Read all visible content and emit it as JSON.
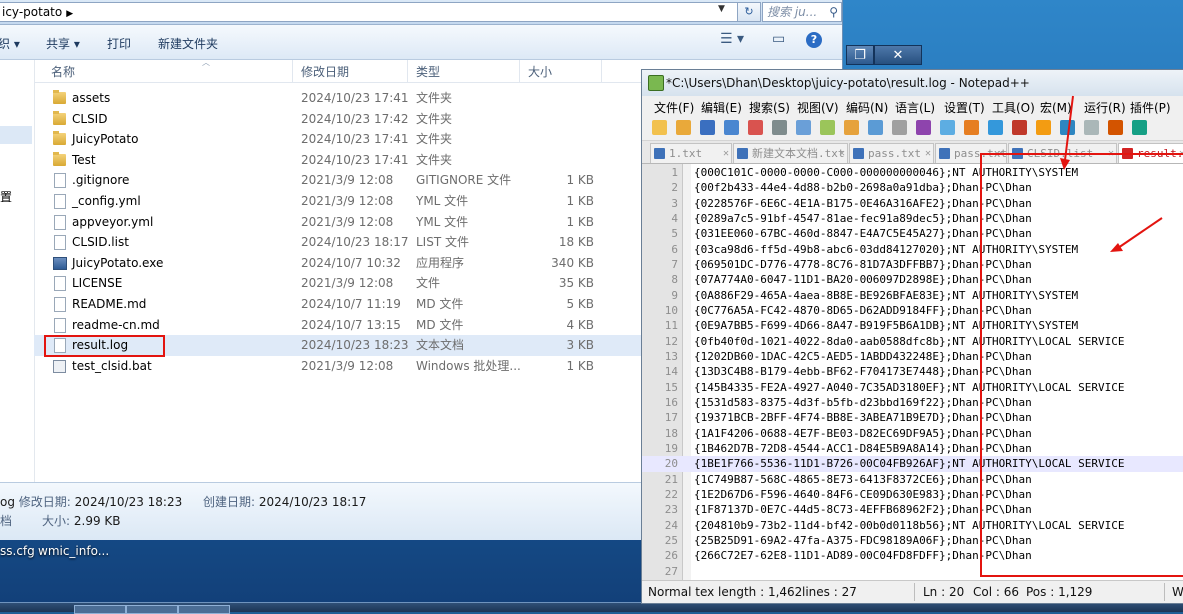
{
  "explorer": {
    "address_path": "icy-potato",
    "search_placeholder": "搜索 ju...",
    "toolbar": {
      "organize": "织 ▾",
      "share": "共享 ▾",
      "print": "打印",
      "new_folder": "新建文件夹"
    },
    "columns": {
      "name": "名称",
      "date": "修改日期",
      "type": "类型",
      "size": "大小"
    },
    "nav_label": "置",
    "files": [
      {
        "icon": "folder",
        "name": "assets",
        "date": "2024/10/23 17:41",
        "type": "文件夹",
        "size": ""
      },
      {
        "icon": "folder",
        "name": "CLSID",
        "date": "2024/10/23 17:42",
        "type": "文件夹",
        "size": ""
      },
      {
        "icon": "folder",
        "name": "JuicyPotato",
        "date": "2024/10/23 17:41",
        "type": "文件夹",
        "size": ""
      },
      {
        "icon": "folder",
        "name": "Test",
        "date": "2024/10/23 17:41",
        "type": "文件夹",
        "size": ""
      },
      {
        "icon": "doc",
        "name": ".gitignore",
        "date": "2021/3/9 12:08",
        "type": "GITIGNORE 文件",
        "size": "1 KB"
      },
      {
        "icon": "doc",
        "name": "_config.yml",
        "date": "2021/3/9 12:08",
        "type": "YML 文件",
        "size": "1 KB"
      },
      {
        "icon": "doc",
        "name": "appveyor.yml",
        "date": "2021/3/9 12:08",
        "type": "YML 文件",
        "size": "1 KB"
      },
      {
        "icon": "doc",
        "name": "CLSID.list",
        "date": "2024/10/23 18:17",
        "type": "LIST 文件",
        "size": "18 KB"
      },
      {
        "icon": "exe",
        "name": "JuicyPotato.exe",
        "date": "2024/10/7 10:32",
        "type": "应用程序",
        "size": "340 KB"
      },
      {
        "icon": "doc",
        "name": "LICENSE",
        "date": "2021/3/9 12:08",
        "type": "文件",
        "size": "35 KB"
      },
      {
        "icon": "doc",
        "name": "README.md",
        "date": "2024/10/7 11:19",
        "type": "MD 文件",
        "size": "5 KB"
      },
      {
        "icon": "doc",
        "name": "readme-cn.md",
        "date": "2024/10/7 13:15",
        "type": "MD 文件",
        "size": "4 KB"
      },
      {
        "icon": "doc",
        "name": "result.log",
        "date": "2024/10/23 18:23",
        "type": "文本文档",
        "size": "3 KB"
      },
      {
        "icon": "bat",
        "name": "test_clsid.bat",
        "date": "2021/3/9 12:08",
        "type": "Windows 批处理...",
        "size": "1 KB"
      }
    ],
    "details": {
      "name_fragment": "og",
      "modified_label": "修改日期:",
      "modified_value": "2024/10/23 18:23",
      "created_label": "创建日期:",
      "created_value": "2024/10/23 18:17",
      "size_label": "大小:",
      "size_value": "2.99 KB",
      "left_fragment": "档"
    }
  },
  "desktop": {
    "labels": [
      "ss.cfg",
      "wmic_info..."
    ]
  },
  "background_window": {
    "restore": "❐",
    "close": "✕"
  },
  "notepad": {
    "title": "*C:\\Users\\Dhan\\Desktop\\juicy-potato\\result.log - Notepad++",
    "menu": [
      "文件(F)",
      "编辑(E)",
      "搜索(S)",
      "视图(V)",
      "编码(N)",
      "语言(L)",
      "设置(T)",
      "工具(O)",
      "宏(M)",
      "运行(R)",
      "插件(P)"
    ],
    "tabs": [
      "1.txt",
      "新建文本文档.txt",
      "pass.txt",
      "pass.txt",
      "CLSID.list",
      "result.log"
    ],
    "lines": [
      "{000C101C-0000-0000-C000-000000000046};NT AUTHORITY\\SYSTEM",
      "{00f2b433-44e4-4d88-b2b0-2698a0a91dba};Dhan-PC\\Dhan",
      "{0228576F-6E6C-4E1A-B175-0E46A316AFE2};Dhan-PC\\Dhan",
      "{0289a7c5-91bf-4547-81ae-fec91a89dec5};Dhan-PC\\Dhan",
      "{031EE060-67BC-460d-8847-E4A7C5E45A27};Dhan-PC\\Dhan",
      "{03ca98d6-ff5d-49b8-abc6-03dd84127020};NT AUTHORITY\\SYSTEM",
      "{069501DC-D776-4778-8C76-81D7A3DFFBB7};Dhan-PC\\Dhan",
      "{07A774A0-6047-11D1-BA20-006097D2898E};Dhan-PC\\Dhan",
      "{0A886F29-465A-4aea-8B8E-BE926BFAE83E};NT AUTHORITY\\SYSTEM",
      "{0C776A5A-FC42-4870-8D65-D62ADD9184FF};Dhan-PC\\Dhan",
      "{0E9A7BB5-F699-4D66-8A47-B919F5B6A1DB};NT AUTHORITY\\SYSTEM",
      "{0fb40f0d-1021-4022-8da0-aab0588dfc8b};NT AUTHORITY\\LOCAL SERVICE",
      "{1202DB60-1DAC-42C5-AED5-1ABDD432248E};Dhan-PC\\Dhan",
      "{13D3C4B8-B179-4ebb-BF62-F704173E7448};Dhan-PC\\Dhan",
      "{145B4335-FE2A-4927-A040-7C35AD3180EF};NT AUTHORITY\\LOCAL SERVICE",
      "{1531d583-8375-4d3f-b5fb-d23bbd169f22};Dhan-PC\\Dhan",
      "{19371BCB-2BFF-4F74-BB8E-3ABEA71B9E7D};Dhan-PC\\Dhan",
      "{1A1F4206-0688-4E7F-BE03-D82EC69DF9A5};Dhan-PC\\Dhan",
      "{1B462D7B-72D8-4544-ACC1-D84E5B9A8A14};Dhan-PC\\Dhan",
      "{1BE1F766-5536-11D1-B726-00C04FB926AF};NT AUTHORITY\\LOCAL SERVICE",
      "{1C749B87-568C-4865-8E73-6413F8372CE6};Dhan-PC\\Dhan",
      "{1E2D67D6-F596-4640-84F6-CE09D630E983};Dhan-PC\\Dhan",
      "{1F87137D-0E7C-44d5-8C73-4EFFB68962F2};Dhan-PC\\Dhan",
      "{204810b9-73b2-11d4-bf42-00b0d0118b56};NT AUTHORITY\\LOCAL SERVICE",
      "{25B25D91-69A2-47fa-A375-FDC98189A06F};Dhan-PC\\Dhan",
      "{266C72E7-62E8-11D1-AD89-00C04FD8FDFF};Dhan-PC\\Dhan",
      ""
    ],
    "current_line": 20,
    "status": {
      "length": "Normal tex length : 1,462",
      "lines": "lines : 27",
      "ln": "Ln : 20",
      "col": "Col : 66",
      "pos": "Pos : 1,129",
      "eol": "W"
    }
  }
}
